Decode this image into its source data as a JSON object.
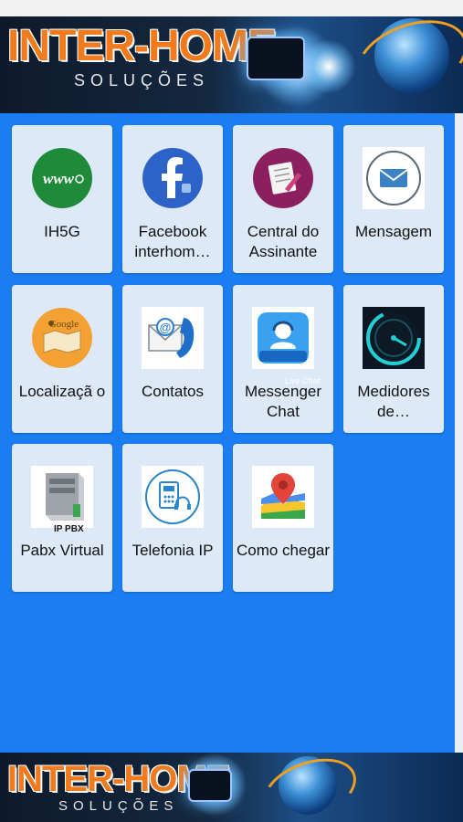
{
  "brand": {
    "title": "INTER-HOME",
    "subtitle": "SOLUÇÕES"
  },
  "tiles": [
    {
      "label": "IH5G",
      "icon": "www-globe-icon"
    },
    {
      "label": "Facebook interhom…",
      "icon": "facebook-icon"
    },
    {
      "label": "Central do Assinante",
      "icon": "notepad-icon"
    },
    {
      "label": "Mensagem",
      "icon": "envelope-icon"
    },
    {
      "label": "Localizaçã o",
      "icon": "google-map-icon"
    },
    {
      "label": "Contatos",
      "icon": "email-phone-icon"
    },
    {
      "label": "Messenger Chat",
      "icon": "live-chat-icon",
      "badge": "Live Chat"
    },
    {
      "label": "Medidores de…",
      "icon": "speedometer-icon"
    },
    {
      "label": "Pabx Virtual",
      "icon": "ip-pbx-icon",
      "badge": "IP PBX"
    },
    {
      "label": "Telefonia IP",
      "icon": "ip-phone-icon"
    },
    {
      "label": "Como chegar",
      "icon": "map-pin-icon"
    }
  ],
  "colors": {
    "main_bg": "#1a7ef2",
    "tile_bg": "#dde9f7",
    "brand_orange": "#f07a1c"
  }
}
